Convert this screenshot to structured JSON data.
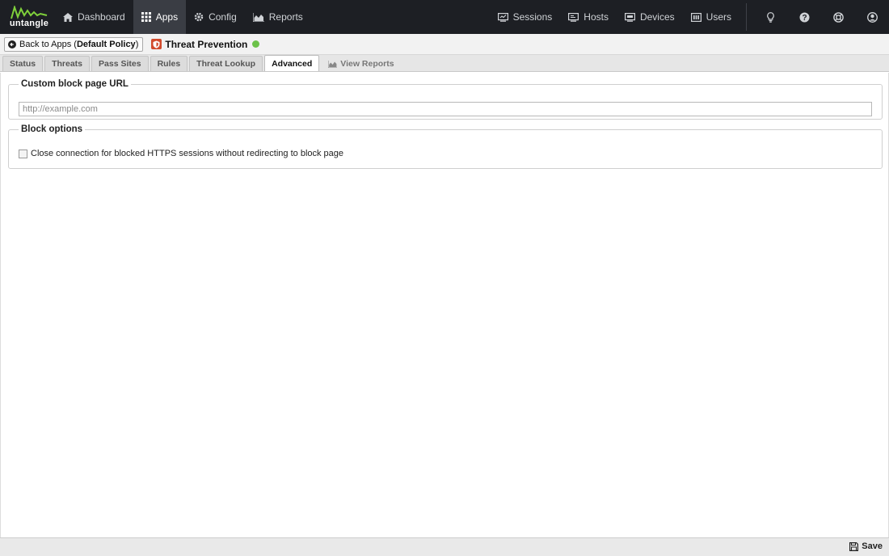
{
  "logo": {
    "text": "untangle",
    "accent": "#7fd13b"
  },
  "nav": {
    "left": [
      {
        "key": "dashboard",
        "label": "Dashboard",
        "icon": "home-icon"
      },
      {
        "key": "apps",
        "label": "Apps",
        "icon": "grid-icon",
        "active": true
      },
      {
        "key": "config",
        "label": "Config",
        "icon": "gear-icon"
      },
      {
        "key": "reports",
        "label": "Reports",
        "icon": "area-chart-icon"
      }
    ],
    "right": [
      {
        "key": "sessions",
        "label": "Sessions",
        "icon": "sessions-icon"
      },
      {
        "key": "hosts",
        "label": "Hosts",
        "icon": "hosts-icon"
      },
      {
        "key": "devices",
        "label": "Devices",
        "icon": "devices-icon"
      },
      {
        "key": "users",
        "label": "Users",
        "icon": "users-icon"
      }
    ],
    "icons": [
      "lightbulb-icon",
      "help-icon",
      "support-icon",
      "account-icon"
    ]
  },
  "titlebar": {
    "back_prefix": "Back to Apps (",
    "back_policy": "Default Policy",
    "back_suffix": ")",
    "app_name": "Threat Prevention",
    "status_color": "#6cc24a"
  },
  "tabs": [
    {
      "label": "Status"
    },
    {
      "label": "Threats"
    },
    {
      "label": "Pass Sites"
    },
    {
      "label": "Rules"
    },
    {
      "label": "Threat Lookup"
    },
    {
      "label": "Advanced",
      "active": true
    },
    {
      "label": "View Reports"
    }
  ],
  "sections": {
    "custom_block": {
      "legend": "Custom block page URL",
      "input_value": "",
      "input_placeholder": "http://example.com"
    },
    "block_options": {
      "legend": "Block options",
      "checkbox_label": "Close connection for blocked HTTPS sessions without redirecting to block page",
      "checked": false
    }
  },
  "footer": {
    "save_label": "Save"
  }
}
